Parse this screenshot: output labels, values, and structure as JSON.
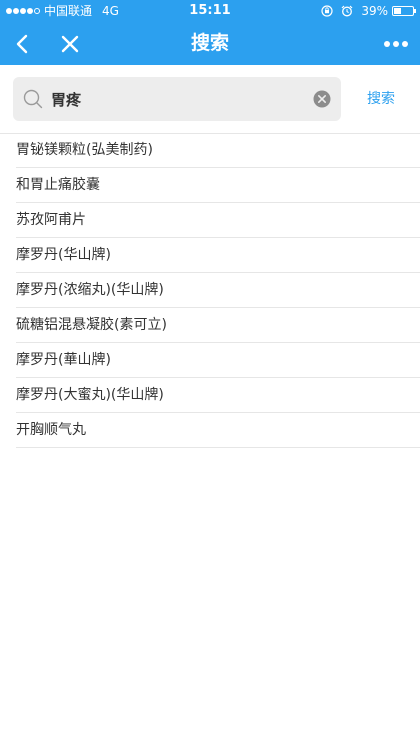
{
  "status_bar": {
    "carrier": "中国联通",
    "network": "4G",
    "time": "15:11",
    "battery_text": "39%",
    "battery_level": 0.39
  },
  "nav": {
    "title": "搜索",
    "back_icon": "chevron-left-icon",
    "close_icon": "close-icon",
    "more_icon": "more-dots-icon"
  },
  "search": {
    "value": "胃疼",
    "button_label": "搜索"
  },
  "results": [
    "胃铋镁颗粒(弘美制药)",
    "和胃止痛胶囊",
    "苏孜阿甫片",
    "摩罗丹(华山牌)",
    "摩罗丹(浓缩丸)(华山牌)",
    "硫糖铝混悬凝胶(素可立)",
    "摩罗丹(華山牌)",
    "摩罗丹(大蜜丸)(华山牌)",
    "开胸顺气丸"
  ],
  "colors": {
    "accent": "#2ca0ef",
    "input_bg": "#ededed",
    "divider": "#e6e6e6",
    "text": "#333333"
  }
}
